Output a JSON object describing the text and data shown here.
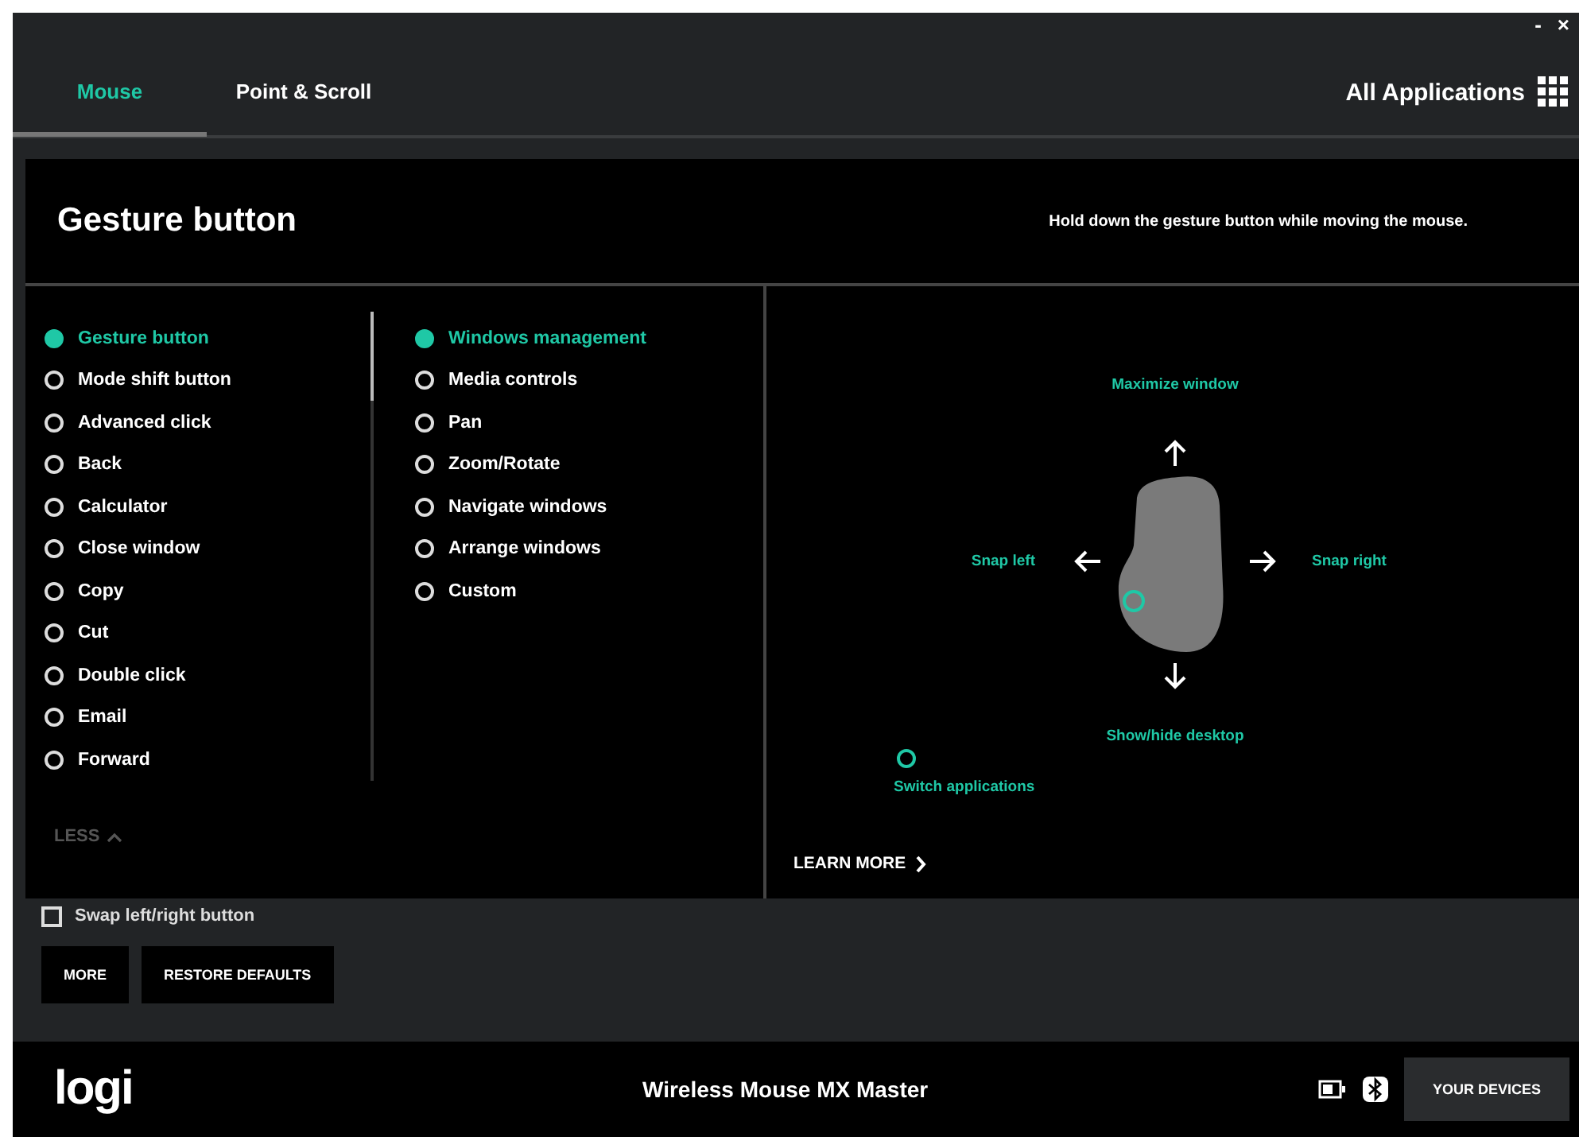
{
  "window": {
    "controls": [
      "-",
      "×"
    ]
  },
  "tabs": [
    {
      "label": "Mouse",
      "selected": true
    },
    {
      "label": "Point & Scroll",
      "selected": false
    }
  ],
  "app_selector": {
    "label": "All Applications"
  },
  "panel": {
    "title": "Gesture button",
    "hint": "Hold down the gesture button while moving the mouse.",
    "buttons": [
      {
        "label": "Gesture button",
        "selected": true
      },
      {
        "label": "Mode shift button",
        "selected": false
      },
      {
        "label": "Advanced click",
        "selected": false
      },
      {
        "label": "Back",
        "selected": false
      },
      {
        "label": "Calculator",
        "selected": false
      },
      {
        "label": "Close window",
        "selected": false
      },
      {
        "label": "Copy",
        "selected": false
      },
      {
        "label": "Cut",
        "selected": false
      },
      {
        "label": "Double click",
        "selected": false
      },
      {
        "label": "Email",
        "selected": false
      },
      {
        "label": "Forward",
        "selected": false
      }
    ],
    "actions": [
      {
        "label": "Windows management",
        "selected": true
      },
      {
        "label": "Media controls",
        "selected": false
      },
      {
        "label": "Pan",
        "selected": false
      },
      {
        "label": "Zoom/Rotate",
        "selected": false
      },
      {
        "label": "Navigate windows",
        "selected": false
      },
      {
        "label": "Arrange windows",
        "selected": false
      },
      {
        "label": "Custom",
        "selected": false
      }
    ],
    "less": "LESS",
    "gestures": [
      {
        "kind": "up",
        "label": "Maximize window"
      },
      {
        "kind": "left",
        "label": "Snap left"
      },
      {
        "kind": "right",
        "label": "Snap right"
      },
      {
        "kind": "down",
        "label": "Show/hide desktop"
      },
      {
        "kind": "click",
        "label": "Switch applications"
      }
    ],
    "learn_more": "LEARN MORE"
  },
  "swap": {
    "label": "Swap left/right button",
    "checked": false
  },
  "bottom_buttons": [
    "MORE",
    "RESTORE DEFAULTS"
  ],
  "footer": {
    "logo": "logi",
    "device": "Wireless Mouse MX Master",
    "devices_button": "YOUR DEVICES"
  }
}
